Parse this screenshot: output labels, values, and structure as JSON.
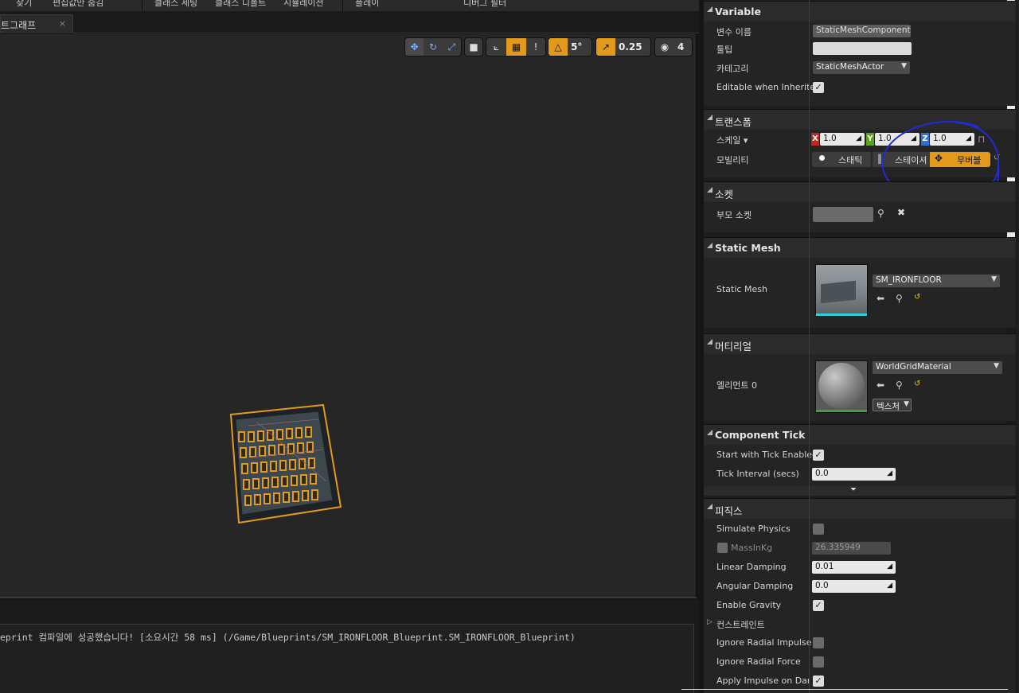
{
  "menubar": {
    "items": [
      "찾기",
      "편집값만 숨김",
      "클래스 세팅",
      "클래스 디폴트",
      "시뮬레이션",
      "플레이",
      "디버그 필터"
    ]
  },
  "tab": {
    "label": "트그래프",
    "close": "×"
  },
  "viewport_toolbar": {
    "grid_snap": "5°",
    "scale_snap": "0.25",
    "camera_speed": "4"
  },
  "log": {
    "message": "eprint 컴파일에 성공했습니다! [소요시간 58 ms] (/Game/Blueprints/SM_IRONFLOOR_Blueprint.SM_IRONFLOOR_Blueprint)"
  },
  "details": {
    "variable": {
      "title": "Variable",
      "name_label": "변수 이름",
      "name_value": "StaticMeshComponent",
      "tooltip_label": "툴팁",
      "tooltip_value": "",
      "category_label": "카테고리",
      "category_value": "StaticMeshActor",
      "editable_label": "Editable when Inherited"
    },
    "transform": {
      "title": "트랜스폼",
      "scale_label": "스케일 ▾",
      "x": "1.0",
      "y": "1.0",
      "z": "1.0",
      "mobility_label": "모빌리티",
      "mobility_static": "스태틱",
      "mobility_stationary": "스테이셔",
      "mobility_movable": "무버블"
    },
    "socket": {
      "title": "소켓",
      "parent_label": "부모 소켓"
    },
    "static_mesh": {
      "title": "Static Mesh",
      "label": "Static Mesh",
      "value": "SM_IRONFLOOR"
    },
    "materials": {
      "title": "머티리얼",
      "element_label": "엘리먼트 0",
      "value": "WorldGridMaterial",
      "texture_btn": "텍스처"
    },
    "component_tick": {
      "title": "Component Tick",
      "start_label": "Start with Tick Enabled",
      "interval_label": "Tick Interval (secs)",
      "interval_value": "0.0"
    },
    "physics": {
      "title": "피직스",
      "simulate_label": "Simulate Physics",
      "mass_label": "MassInKg",
      "mass_value": "26.335949",
      "linear_label": "Linear Damping",
      "linear_value": "0.01",
      "angular_label": "Angular Damping",
      "angular_value": "0.0",
      "gravity_label": "Enable Gravity",
      "constraints_label": "컨스트레인트",
      "radial_impulse_label": "Ignore Radial Impulse",
      "radial_force_label": "Ignore Radial Force",
      "apply_impulse_label": "Apply Impulse on Dama"
    }
  },
  "colors": {
    "accent_orange": "#e39a1b",
    "annotation_blue": "#1f2bd6",
    "axis_x": "#c0271e",
    "axis_y": "#5aa21a",
    "axis_z": "#2f6fd6"
  }
}
